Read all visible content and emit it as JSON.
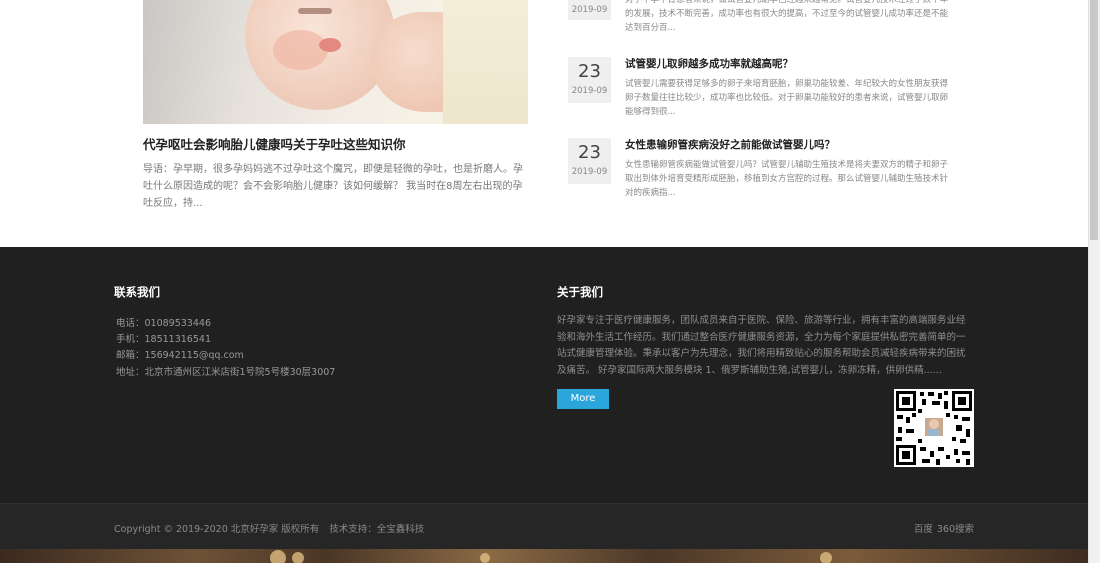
{
  "feature": {
    "title": "代孕呕吐会影响胎儿健康吗关于孕吐这些知识你",
    "desc": "导语：孕早期，很多孕妈妈逃不过孕吐这个魔咒，即便是轻微的孕吐，也是折磨人。孕吐什么原因造成的呢？会不会影响胎儿健康？该如何缓解？ 我当时在8周左右出现的孕吐反应，持..."
  },
  "news": [
    {
      "day": "",
      "ym": "2019-09",
      "title": "",
      "desc": "对于不孕不育患者来说，做试管婴儿助孕已经越来越常见。试管婴儿技术经过了数十年的发展，技术不断完善，成功率也有很大的提高，不过至今的试管婴儿成功率还是不能达到百分百..."
    },
    {
      "day": "23",
      "ym": "2019-09",
      "title": "试管婴儿取卵越多成功率就越高呢？",
      "desc": "试管婴儿需要获得足够多的卵子来培育胚胎，卵巢功能较差、年纪较大的女性朋友获得卵子数量往往比较少，成功率也比较低。对于卵巢功能较好的患者来说，试管婴儿取卵能够得到很..."
    },
    {
      "day": "23",
      "ym": "2019-09",
      "title": "女性患输卵管疾病没好之前能做试管婴儿吗？",
      "desc": "女性患输卵管疾病能做试管婴儿吗？试管婴儿辅助生殖技术是将夫妻双方的精子和卵子取出到体外培育受精形成胚胎，移植到女方宫腔的过程。那么试管婴儿辅助生殖技术针对的疾病指..."
    }
  ],
  "footer": {
    "contact_heading": "联系我们",
    "phone": "电话：01089533446",
    "mobile": "手机：18511316541",
    "email": "邮箱：156942115@qq.com",
    "address": "地址：北京市通州区江米店街1号院5号楼30层3007",
    "about_heading": "关于我们",
    "about_text": "好孕家专注于医疗健康服务，团队成员来自于医院、保险、旅游等行业，拥有丰富的高端服务业经验和海外生活工作经历。我们通过整合医疗健康服务资源，全力为每个家庭提供私密完善简单的一站式健康管理体验。秉承以客户为先理念，我们将用精致贴心的服务帮助会员减轻疾病带来的困扰及痛苦。 好孕家国际两大服务模块 1、俄罗斯辅助生殖,试管婴儿，冻卵冻精，供卵供精......",
    "more_label": "More",
    "copyright": "Copyright © 2019-2020 北京好孕家 版权所有",
    "tech_support": "技术支持：全宝鑫科技",
    "links": [
      "百度",
      "360搜索"
    ]
  },
  "colors": {
    "footer_bg": "#202020",
    "footer_bottom_bg": "#262626",
    "accent": "#2aa6dd"
  }
}
